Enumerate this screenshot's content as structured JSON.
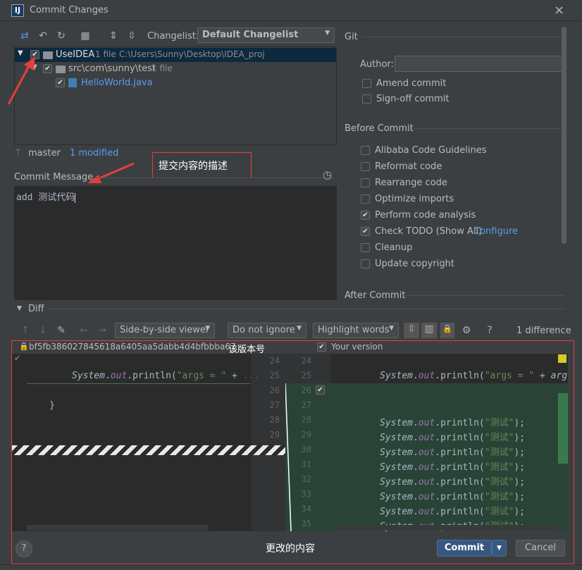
{
  "window": {
    "title": "Commit Changes",
    "app_icon": "IJ",
    "close": "×"
  },
  "toolbar": {
    "changelist_label": "Changelist:",
    "changelist_value": "Default Changelist"
  },
  "tree": {
    "root": {
      "name": "UseIDEA",
      "count": "1 file",
      "path": "C:\\Users\\Sunny\\Desktop\\IDEA_proj"
    },
    "pkg": {
      "name": "src\\com\\sunny\\test",
      "count": "1 file"
    },
    "file": {
      "name": "HelloWorld.java"
    }
  },
  "vcs": {
    "branch": "master",
    "modified": "1 modified"
  },
  "commit_message": {
    "label": "Commit Message",
    "text": "add 测试代码"
  },
  "annotation": {
    "message": "提交内容的描述",
    "version": "该版本号",
    "changes": "更改的内容"
  },
  "git": {
    "section": "Git",
    "author_label": "Author:",
    "author_value": "",
    "amend": "Amend commit",
    "signoff": "Sign-off commit"
  },
  "before_commit": {
    "section": "Before Commit",
    "options": [
      {
        "label": "Alibaba Code Guidelines",
        "checked": false
      },
      {
        "label": "Reformat code",
        "checked": false
      },
      {
        "label": "Rearrange code",
        "checked": false
      },
      {
        "label": "Optimize imports",
        "checked": false
      },
      {
        "label": "Perform code analysis",
        "checked": true
      },
      {
        "label": "Check TODO (Show All)",
        "checked": true
      },
      {
        "label": "Cleanup",
        "checked": false
      },
      {
        "label": "Update copyright",
        "checked": false
      }
    ],
    "configure_link": "Configure"
  },
  "after_commit": {
    "section": "After Commit"
  },
  "diff": {
    "section": "Diff",
    "viewer": "Side-by-side viewer",
    "ignore": "Do not ignore",
    "highlight": "Highlight words",
    "help": "?",
    "count": "1 difference",
    "left_header": "bf5fb386027845618a6405aa5dabb4d4bfbbba67",
    "right_header": "Your version",
    "left_code": {
      "line25": "System.out.println(\"args = \" + ",
      "line27": "}"
    },
    "right_code_line25": "System.out.println(\"args = \" + arg",
    "right_line": "System.out.println(\"测试\");",
    "left_lines": [
      "24",
      "25",
      "26",
      "27",
      "28",
      "29"
    ],
    "right_lines": [
      "24",
      "25",
      "26",
      "27",
      "28",
      "29",
      "30",
      "31",
      "32",
      "33",
      "34",
      "35"
    ]
  },
  "buttons": {
    "help": "?",
    "commit": "Commit",
    "cancel": "Cancel"
  },
  "colors": {
    "accent": "#365880",
    "annotation": "#e53e3e",
    "added": "#294436",
    "link": "#589df6"
  }
}
